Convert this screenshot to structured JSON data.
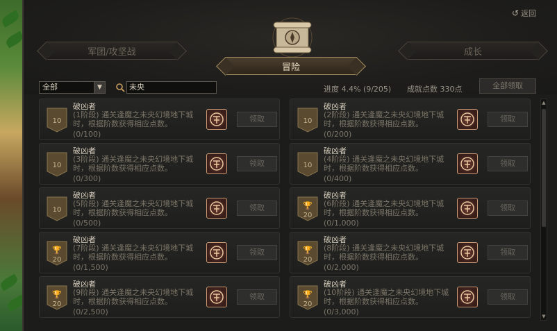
{
  "header": {
    "back_label": "返回",
    "tab_left": "军团/攻坚战",
    "tab_center": "冒险",
    "tab_right": "成长"
  },
  "filters": {
    "category_selected": "全部",
    "search_value": "未央"
  },
  "stats": {
    "progress": "进度 4.4% (9/205)",
    "points": "成就点数 330点",
    "claim_all_label": "全部领取"
  },
  "achievements": [
    {
      "badge": "10",
      "trophy": false,
      "title": "破凶者",
      "desc": "(1阶段) 通关逢魔之未央幻境地下城时，根据阶数获得相应点数。",
      "count": "(0/100)",
      "claim": "领取"
    },
    {
      "badge": "10",
      "trophy": false,
      "title": "破凶者",
      "desc": "(2阶段) 通关逢魔之未央幻境地下城时，根据阶数获得相应点数。",
      "count": "(0/200)",
      "claim": "领取"
    },
    {
      "badge": "10",
      "trophy": false,
      "title": "破凶者",
      "desc": "(3阶段) 通关逢魔之未央幻境地下城时，根据阶数获得相应点数。",
      "count": "(0/300)",
      "claim": "领取"
    },
    {
      "badge": "10",
      "trophy": false,
      "title": "破凶者",
      "desc": "(4阶段) 通关逢魔之未央幻境地下城时，根据阶数获得相应点数。",
      "count": "(0/400)",
      "claim": "领取"
    },
    {
      "badge": "10",
      "trophy": false,
      "title": "破凶者",
      "desc": "(5阶段) 通关逢魔之未央幻境地下城时，根据阶数获得相应点数。",
      "count": "(0/500)",
      "claim": "领取"
    },
    {
      "badge": "20",
      "trophy": true,
      "title": "破凶者",
      "desc": "(6阶段) 通关逢魔之未央幻境地下城时，根据阶数获得相应点数。",
      "count": "(0/1,000)",
      "claim": "领取"
    },
    {
      "badge": "20",
      "trophy": true,
      "title": "破凶者",
      "desc": "(7阶段) 通关逢魔之未央幻境地下城时，根据阶数获得相应点数。",
      "count": "(0/1,500)",
      "claim": "领取"
    },
    {
      "badge": "20",
      "trophy": true,
      "title": "破凶者",
      "desc": "(8阶段) 通关逢魔之未央幻境地下城时，根据阶数获得相应点数。",
      "count": "(0/2,000)",
      "claim": "领取"
    },
    {
      "badge": "20",
      "trophy": true,
      "title": "破凶者",
      "desc": "(9阶段) 通关逢魔之未央幻境地下城时，根据阶数获得相应点数。",
      "count": "(0/2,500)",
      "claim": "领取"
    },
    {
      "badge": "20",
      "trophy": true,
      "title": "破凶者",
      "desc": "(10阶段) 通关逢魔之未央幻境地下城时，根据阶数获得相应点数。",
      "count": "(0/3,000)",
      "claim": "领取"
    }
  ],
  "colors": {
    "panel_bg": "#1c1c1b",
    "accent_gold": "#a08c60",
    "reward_border": "#c89a78"
  },
  "icons": {
    "back": "return-arrow-icon",
    "search": "search-icon",
    "dropdown": "dropdown-arrow-icon",
    "emblem": "scroll-compass-emblem",
    "reward": "reward-box-icon",
    "trophy": "trophy-icon"
  }
}
